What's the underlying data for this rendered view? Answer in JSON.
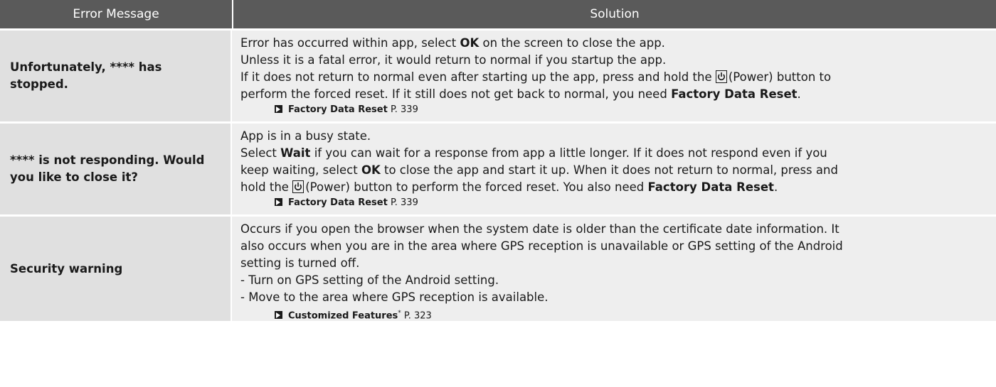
{
  "header": {
    "col1": "Error Message",
    "col2": "Solution"
  },
  "rows": [
    {
      "message": "Unfortunately, **** has stopped.",
      "s1_pre": "Error has occurred within app, select ",
      "s1_bold": "OK",
      "s1_post": " on the screen to close the app.",
      "s2": "Unless it is a fatal error, it would return to normal if you startup the app.",
      "s3_pre": "If it does not return to normal even after starting up the app, press and hold the ",
      "s3_post": "(Power) button to",
      "s4_pre": "perform the forced reset. If it still does not get back to normal, you need ",
      "s4_bold": "Factory Data Reset",
      "s4_post": ".",
      "ref_label": "Factory Data Reset",
      "ref_page": " P. 339"
    },
    {
      "message": "**** is not responding. Would you like to close it?",
      "s1": "App is in a busy state.",
      "s2_pre": "Select ",
      "s2_bold": "Wait",
      "s2_post": " if you can wait for a response from app a little longer. If it does not respond even if you",
      "s3_pre": "keep waiting, select ",
      "s3_bold": "OK",
      "s3_post": " to close the app and start it up. When it does not return to normal, press and",
      "s4_pre": "hold the ",
      "s4_mid": "(Power) button to perform the forced reset. You also need ",
      "s4_bold": "Factory Data Reset",
      "s4_post": ".",
      "ref_label": "Factory Data Reset",
      "ref_page": " P. 339"
    },
    {
      "message": "Security warning",
      "s1": "Occurs if you open the browser when the system date is older than the certificate date information. It",
      "s2": "also occurs when you are in the area where GPS reception is unavailable or GPS setting of the Android",
      "s3": "setting is turned off.",
      "s4": "- Turn on GPS setting of the Android setting.",
      "s5": "- Move to the area where GPS reception is available.",
      "ref_label": "Customized Features",
      "ref_star": "*",
      "ref_page": " P. 323"
    }
  ]
}
